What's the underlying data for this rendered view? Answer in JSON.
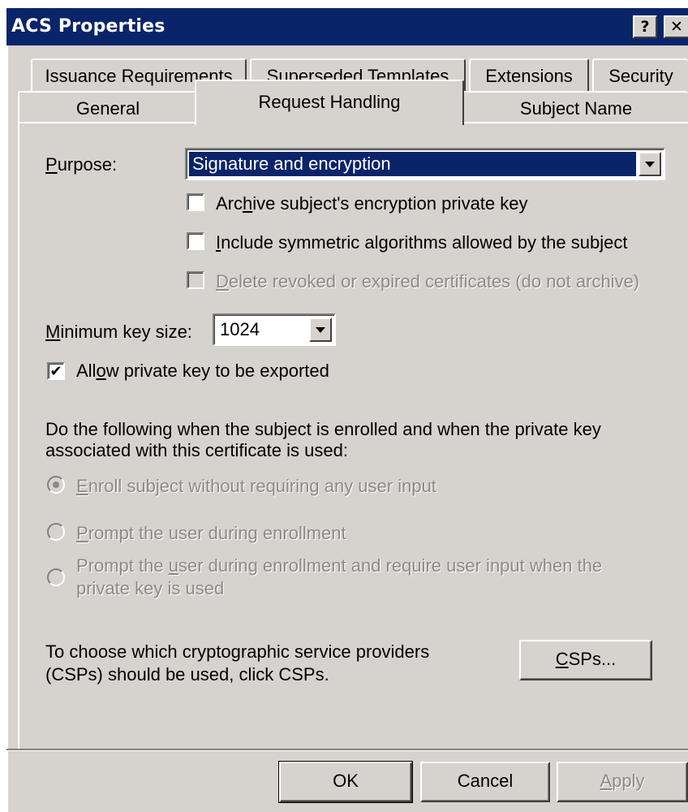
{
  "window": {
    "title": "ACS Properties",
    "help_label": "?",
    "close_label": "✕"
  },
  "tabs": {
    "row1": [
      "Issuance Requirements",
      "Superseded Templates",
      "Extensions",
      "Security"
    ],
    "row2": [
      "General",
      "Request Handling",
      "Subject Name"
    ],
    "active": "Request Handling"
  },
  "purpose": {
    "label_mnemonic": "P",
    "label_rest": "urpose:",
    "value": "Signature and encryption"
  },
  "options": {
    "archive_pre": "Arc",
    "archive_mn": "h",
    "archive_post": "ive subject's encryption private key",
    "archive_checked": false,
    "include_mn": "I",
    "include_post": "nclude symmetric algorithms allowed by the subject",
    "include_checked": false,
    "delete_mn": "D",
    "delete_post": "elete revoked or expired certificates (do not archive)",
    "delete_checked": false
  },
  "keysize": {
    "label_mnemonic": "M",
    "label_rest": "inimum key size:",
    "value": "1024"
  },
  "export": {
    "pre": "All",
    "mn": "o",
    "post": "w private key to be exported",
    "checked": true,
    "mark": "✔"
  },
  "enrollment": {
    "description_line1": "Do the following when the subject is enrolled and when the private key",
    "description_line2": "associated with this certificate is used:",
    "opt1_mn": "E",
    "opt1_post": "nroll subject without requiring any user input",
    "opt2_mn": "P",
    "opt2_post": "rompt the user during enrollment",
    "opt3_pre": "Prompt the ",
    "opt3_mn": "u",
    "opt3_post": "ser during enrollment and require user input when the",
    "opt3_line2": "private key is used",
    "selected": 1
  },
  "csp": {
    "description_line1": "To choose which cryptographic service providers",
    "description_line2": "(CSPs) should be used, click CSPs.",
    "button_mn": "C",
    "button_post": "SPs..."
  },
  "footer": {
    "ok": "OK",
    "cancel": "Cancel",
    "apply_mn": "A",
    "apply_post": "pply"
  }
}
